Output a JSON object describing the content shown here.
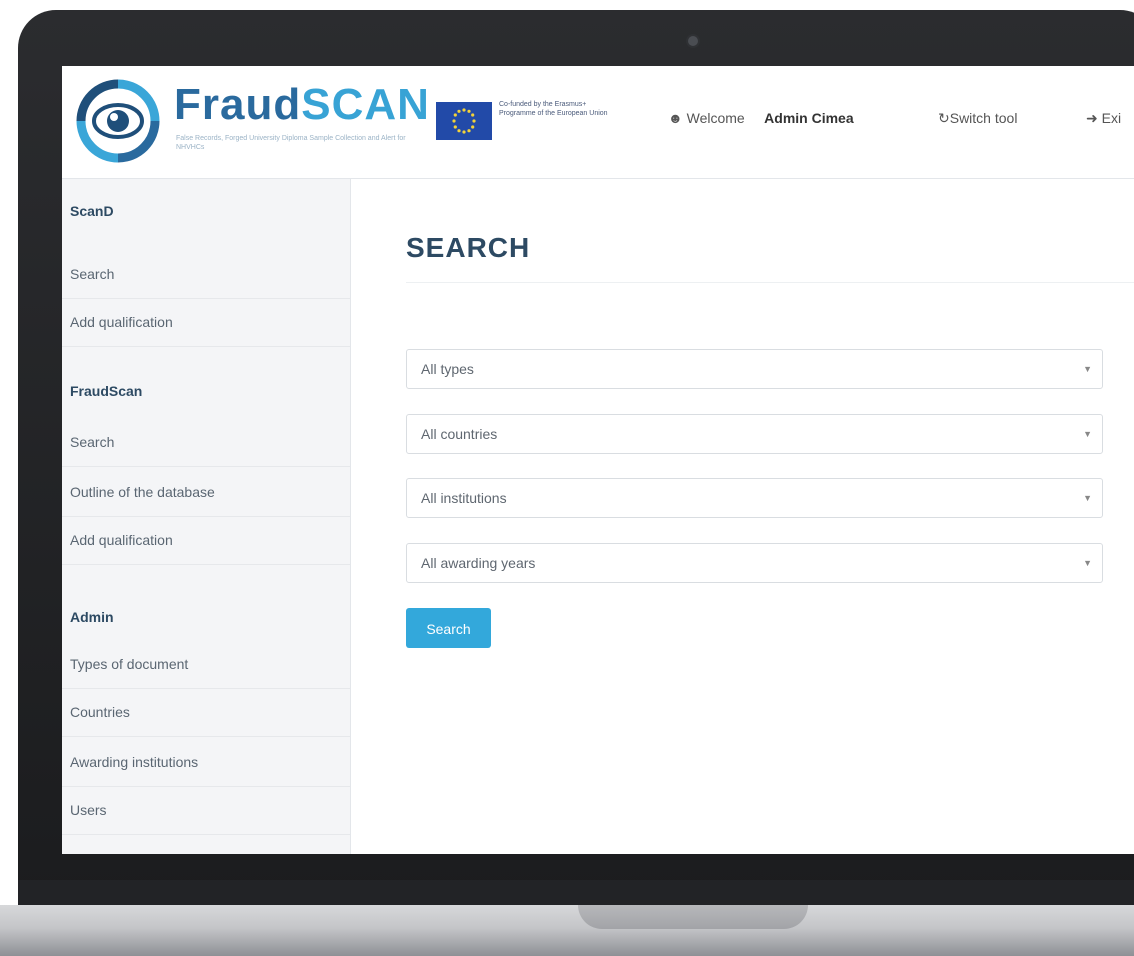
{
  "header": {
    "logo_text_main": "Fraud",
    "logo_text_accent": "SCAN",
    "logo_tagline": "False Records, Forged University Diploma Sample Collection and Alert for NHVHCs",
    "eu_cofund_text": "Co-funded by the Erasmus+ Programme of the European Union",
    "welcome_label": "Welcome",
    "user_name": "Admin Cimea",
    "switch_tool_label": "Switch tool",
    "exit_label": "Exi"
  },
  "sidebar": {
    "sections": [
      {
        "heading": "ScanD",
        "items": [
          "Search",
          "Add qualification"
        ]
      },
      {
        "heading": "FraudScan",
        "items": [
          "Search",
          "Outline of the database",
          "Add qualification"
        ]
      },
      {
        "heading": "Admin",
        "items": [
          "Types of document",
          "Countries",
          "Awarding institutions",
          "Users"
        ]
      }
    ]
  },
  "main": {
    "title": "SEARCH",
    "filters": [
      {
        "selected": "All types"
      },
      {
        "selected": "All countries"
      },
      {
        "selected": "All institutions"
      },
      {
        "selected": "All awarding years"
      }
    ],
    "search_button_label": "Search"
  },
  "colors": {
    "brand_dark": "#2a6a9e",
    "brand_light": "#38a3d5",
    "button_bg": "#33a8db",
    "heading": "#2d4a63"
  },
  "icons": {
    "user": "user-icon",
    "switch": "refresh-icon",
    "exit": "sign-out-icon",
    "select_caret": "caret-down-icon"
  }
}
